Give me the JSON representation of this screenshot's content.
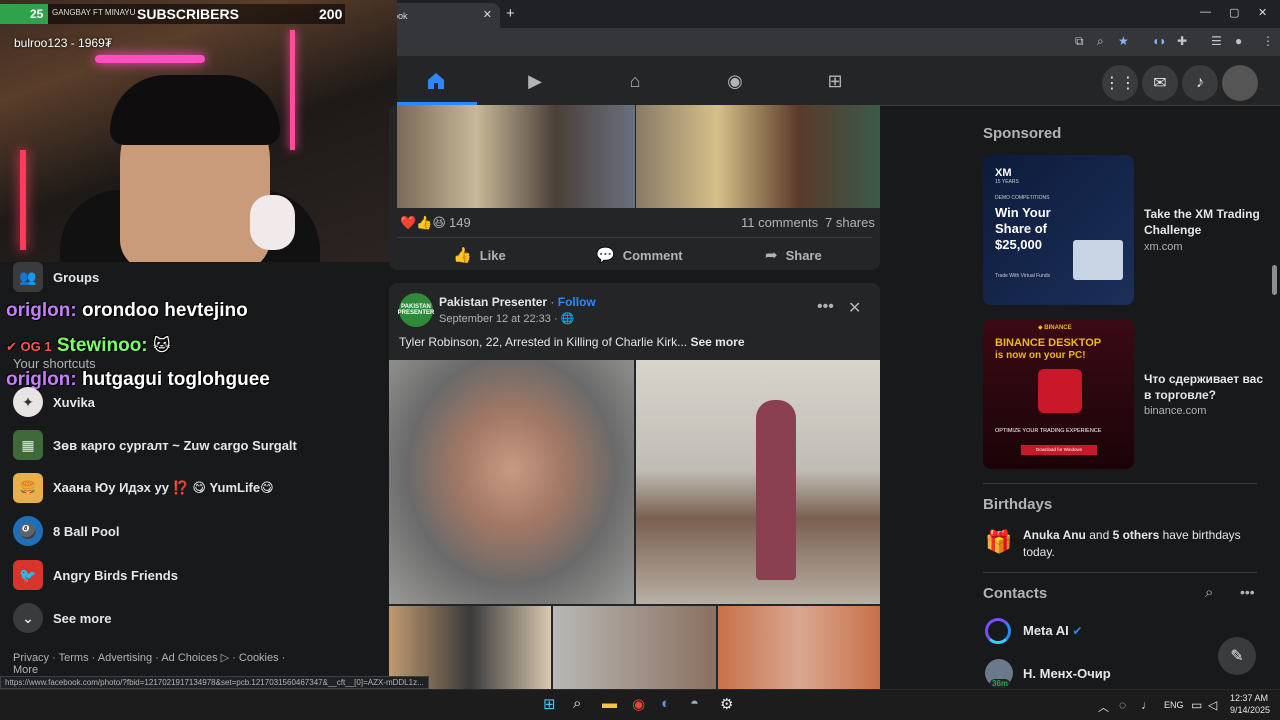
{
  "browser": {
    "tab_title": "Facebook",
    "tab_icon": "f",
    "new_tab": "+",
    "status_url": "https://www.facebook.com/photo/?fbid=1217021917134978&set=pcb.1217031560467347&__cft__[0]=AZX-mDDL1z...",
    "window_min": "—",
    "window_max": "▢",
    "window_close": "✕"
  },
  "stream_overlay": {
    "level_badge": "25",
    "small_text": "GANGBAY FT MINAYU",
    "subscribers_label": "SUBSCRIBERS",
    "subscribers_count": "200",
    "donor_text": "bulroo123 - 1969₮",
    "chat": [
      {
        "name": "origlon:",
        "message": "orondoo hevtejino"
      },
      {
        "name": "Stewinoo:",
        "message": "",
        "badges": "✔ OG 1"
      },
      {
        "name": "origlon:",
        "message": "hutgagui toglohguee"
      }
    ]
  },
  "sidebar": {
    "groups_label": "Groups",
    "shortcuts_header": "Your shortcuts",
    "shortcuts": [
      {
        "label": "Xuvika"
      },
      {
        "label": "Зөв карго сургалт ~ Zuw cargo Surgalt"
      },
      {
        "label": "Хаана Юу Идэх уу ⁉️ 😋 YumLife😋"
      },
      {
        "label": "8 Ball Pool"
      },
      {
        "label": "Angry Birds Friends"
      }
    ],
    "see_more": "See more",
    "footer": "Privacy · Terms · Advertising · Ad Choices ▷ · Cookies · More"
  },
  "feed": {
    "post1": {
      "reaction_count": "149",
      "comments": "11 comments",
      "shares": "7 shares",
      "like": "Like",
      "comment": "Comment",
      "share": "Share"
    },
    "post2": {
      "page_name": "Pakistan Presenter",
      "follow": "Follow",
      "date": "September 12 at 22:33 · 🌐",
      "text": "Tyler Robinson, 22, Arrested in Killing of Charlie Kirk...",
      "see_more": "See more",
      "avatar_text": "PAKISTAN PRESENTER"
    }
  },
  "right": {
    "sponsored": "Sponsored",
    "ads": [
      {
        "title": "Take the XM Trading Challenge",
        "domain": "xm.com",
        "img_lines": [
          "XM",
          "15 YEARS",
          "DEMO COMPETITIONS",
          "Win Your Share of $25,000",
          "Trade With Virtual Funds"
        ]
      },
      {
        "title": "Что сдерживает вас в торговле?",
        "domain": "binance.com",
        "img_lines": [
          "◆ BINANCE",
          "BINANCE DESKTOP",
          "is now on your PC!",
          "OPTIMIZE YOUR TRADING EXPERIENCE",
          "Download for Windows"
        ]
      }
    ],
    "birthdays_header": "Birthdays",
    "birthday_name": "Anuka Anu",
    "birthday_and": " and ",
    "birthday_others": "5 others",
    "birthday_rest": " have birthdays today.",
    "contacts_header": "Contacts",
    "contacts": [
      {
        "name": "Meta AI"
      },
      {
        "name": "Н. Менх-Очир",
        "badge": "36m"
      }
    ]
  },
  "taskbar": {
    "lang": "ENG",
    "time": "12:37 AM",
    "date": "9/14/2025"
  },
  "colors": {
    "fb_blue": "#2d88ff",
    "background": "#18191a",
    "card": "#242526"
  }
}
